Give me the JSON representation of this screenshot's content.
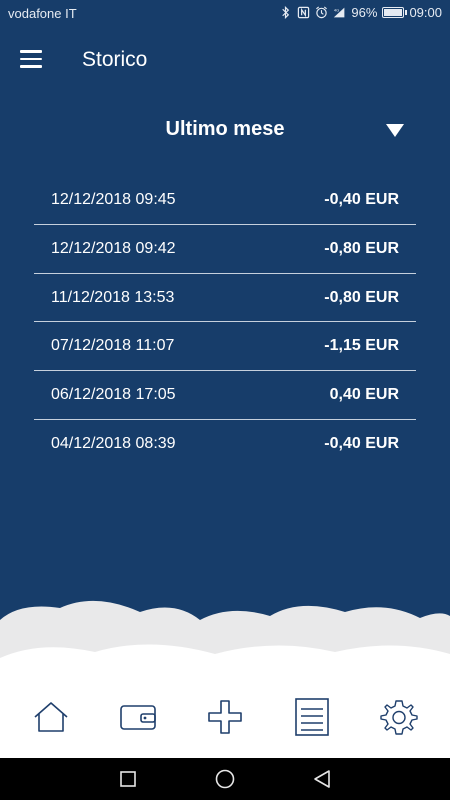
{
  "status_bar": {
    "carrier": "vodafone IT",
    "battery": "96%",
    "battery_level": 0.96,
    "time": "09:00",
    "icons": [
      "bluetooth-icon",
      "nfc-icon",
      "alarm-icon",
      "signal-icon",
      "battery-icon"
    ]
  },
  "app_bar": {
    "title": "Storico",
    "menu_icon": "hamburger-menu-icon"
  },
  "period_selector": {
    "label": "Ultimo mese",
    "icon": "dropdown-caret-icon"
  },
  "transactions": [
    {
      "date": "12/12/2018 09:45",
      "amount": "-0,40 EUR"
    },
    {
      "date": "12/12/2018 09:42",
      "amount": "-0,80 EUR"
    },
    {
      "date": "11/12/2018 13:53",
      "amount": "-0,80 EUR"
    },
    {
      "date": "07/12/2018 11:07",
      "amount": "-1,15 EUR"
    },
    {
      "date": "06/12/2018 17:05",
      "amount": "0,40 EUR"
    },
    {
      "date": "04/12/2018 08:39",
      "amount": "-0,40 EUR"
    }
  ],
  "bottom_nav": {
    "items": [
      "home-icon",
      "wallet-icon",
      "add-icon",
      "history-list-icon",
      "settings-gear-icon"
    ],
    "active": "history-list-icon"
  },
  "system_nav": {
    "items": [
      "recent-apps-icon",
      "home-circle-icon",
      "back-triangle-icon"
    ]
  },
  "colors": {
    "background": "#173d6a",
    "divider": "#c6d0dd",
    "cloud": "#e9e9ea",
    "nav_icon": "#1f3f6c"
  }
}
